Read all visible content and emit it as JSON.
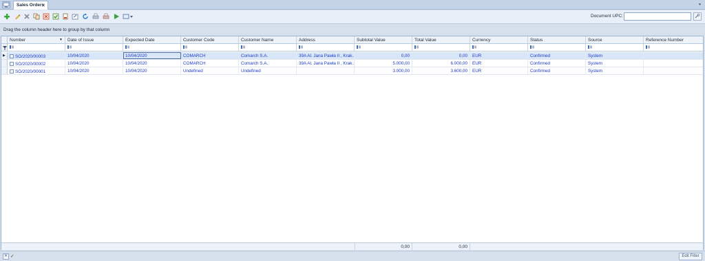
{
  "tab": {
    "title": "Sales Orders",
    "close_glyph": "✕",
    "menu_glyph": "▾"
  },
  "toolbar": {
    "buttons": [
      "add-icon",
      "edit-icon",
      "delete-icon",
      "copy-icon",
      "cancel-document-icon",
      "approve-icon",
      "document-icon",
      "export-icon",
      "refresh-icon",
      "print-icon",
      "print-settings-icon",
      "send-icon",
      "switch-icon"
    ],
    "upc_label": "Document UPC:",
    "upc_value": ""
  },
  "group_panel": {
    "text": "Drag the column header here to group by that column"
  },
  "columns": [
    "Number",
    "Date of Issue",
    "Expected Date",
    "Customer Code",
    "Customer Name",
    "Address",
    "Subtotal Value",
    "Total Value",
    "Currency",
    "Status",
    "Source",
    "Reference Number"
  ],
  "rows": [
    {
      "number": "SO/2020/00003",
      "date_of_issue": "10/04/2020",
      "expected_date": "10/04/2020",
      "customer_code": "COMARCH",
      "customer_name": "Comarch S.A.",
      "address": "39A Al. Jana Pawła II , Krak...",
      "subtotal": "0,00",
      "total": "0,00",
      "currency": "EUR",
      "status": "Confirmed",
      "source": "System",
      "reference": ""
    },
    {
      "number": "SO/2020/00002",
      "date_of_issue": "10/04/2020",
      "expected_date": "10/04/2020",
      "customer_code": "COMARCH",
      "customer_name": "Comarch S.A.",
      "address": "39A Al. Jana Pawła II , Krak...",
      "subtotal": "5.000,00",
      "total": "6.000,00",
      "currency": "EUR",
      "status": "Confirmed",
      "source": "System",
      "reference": ""
    },
    {
      "number": "SO/2020/00001",
      "date_of_issue": "10/04/2020",
      "expected_date": "10/04/2020",
      "customer_code": "Undefined",
      "customer_name": "Undefined",
      "address": "",
      "subtotal": "3.000,00",
      "total": "3.600,00",
      "currency": "EUR",
      "status": "Confirmed",
      "source": "System",
      "reference": ""
    }
  ],
  "footer": {
    "subtotal_sum": "0,00",
    "total_sum": "0,00"
  },
  "statusbar": {
    "clear_glyph": "✕",
    "check_glyph": "✓",
    "edit_filter": "Edit Filter"
  },
  "colors": {
    "accent_text": "#1d3bc9",
    "selected_row": "#d8e6f8",
    "header_bg": "#eef3fa",
    "chrome": "#d6dfec"
  }
}
